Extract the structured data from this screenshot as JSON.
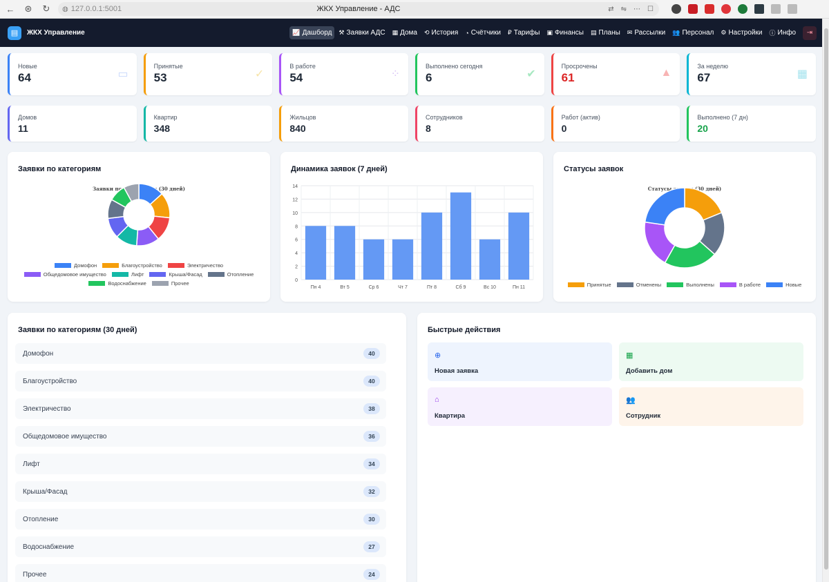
{
  "browser": {
    "url": "127.0.0.1:5001",
    "title": "ЖКХ Управление - АДС"
  },
  "navbar": {
    "brand": "ЖКХ Управление",
    "items": [
      {
        "label": "Дашборд",
        "icon": "chart-line-icon",
        "glyph": "📈"
      },
      {
        "label": "Заявки АДС",
        "icon": "tools-icon",
        "glyph": "⚒"
      },
      {
        "label": "Дома",
        "icon": "building-icon",
        "glyph": "▦"
      },
      {
        "label": "История",
        "icon": "history-icon",
        "glyph": "⟲"
      },
      {
        "label": "Счётчики",
        "icon": "gauge-icon",
        "glyph": "◔"
      },
      {
        "label": "Тарифы",
        "icon": "ruble-icon",
        "glyph": "₽"
      },
      {
        "label": "Финансы",
        "icon": "money-icon",
        "glyph": "▣"
      },
      {
        "label": "Планы",
        "icon": "calendar-icon",
        "glyph": "▤"
      },
      {
        "label": "Рассылки",
        "icon": "envelope-icon",
        "glyph": "✉"
      },
      {
        "label": "Персонал",
        "icon": "users-icon",
        "glyph": "👥"
      },
      {
        "label": "Настройки",
        "icon": "gear-icon",
        "glyph": "⚙"
      },
      {
        "label": "Инфо",
        "icon": "info-icon",
        "glyph": "ⓘ"
      }
    ]
  },
  "stats_row1": [
    {
      "label": "Новые",
      "value": "64",
      "color": "#3b82f6",
      "value_color": "#1f2937",
      "icon": "ticket-icon",
      "glyph": "▭",
      "icon_color": "#c7d7fb"
    },
    {
      "label": "Принятые",
      "value": "53",
      "color": "#f59e0b",
      "value_color": "#1f2937",
      "icon": "check-icon",
      "glyph": "✓",
      "icon_color": "#f7e4a8"
    },
    {
      "label": "В работе",
      "value": "54",
      "color": "#a855f7",
      "value_color": "#1f2937",
      "icon": "spinner-icon",
      "glyph": "⁘",
      "icon_color": "#d9c3f7"
    },
    {
      "label": "Выполнено сегодня",
      "value": "6",
      "color": "#22c55e",
      "value_color": "#1f2937",
      "icon": "check-circle-icon",
      "glyph": "✔",
      "icon_color": "#a7e8c1"
    },
    {
      "label": "Просрочены",
      "value": "61",
      "color": "#ef4444",
      "value_color": "#dc2626",
      "icon": "warning-icon",
      "glyph": "▲",
      "icon_color": "#f8b4b4"
    },
    {
      "label": "За неделю",
      "value": "67",
      "color": "#06b6d4",
      "value_color": "#1f2937",
      "icon": "calendar-week-icon",
      "glyph": "▦",
      "icon_color": "#a5e3ee"
    }
  ],
  "stats_row2": [
    {
      "label": "Домов",
      "value": "11",
      "color": "#6366f1",
      "value_color": "#1f2937"
    },
    {
      "label": "Квартир",
      "value": "348",
      "color": "#14b8a6",
      "value_color": "#1f2937"
    },
    {
      "label": "Жильцов",
      "value": "840",
      "color": "#f59e0b",
      "value_color": "#1f2937"
    },
    {
      "label": "Сотрудников",
      "value": "8",
      "color": "#ef4466",
      "value_color": "#1f2937"
    },
    {
      "label": "Работ (актив)",
      "value": "0",
      "color": "#f97316",
      "value_color": "#1f2937"
    },
    {
      "label": "Выполнено (7 дн)",
      "value": "20",
      "color": "#22c55e",
      "value_color": "#16a34a"
    }
  ],
  "panels": {
    "categories_title": "Заявки по категориям",
    "dynamics_title": "Динамика заявок (7 дней)",
    "statuses_title": "Статусы заявок",
    "list_title": "Заявки по категориям (30 дней)",
    "quick_title": "Быстрые действия"
  },
  "chart_data": [
    {
      "type": "pie",
      "title": "Заявки по категориям (30 дней)",
      "donut": true,
      "legend_position": "bottom",
      "categories": [
        "Домофон",
        "Благоустройство",
        "Электричество",
        "Общедомовое имущество",
        "Лифт",
        "Крыша/Фасад",
        "Отопление",
        "Водоснабжение",
        "Прочее"
      ],
      "values": [
        40,
        40,
        38,
        36,
        34,
        32,
        30,
        27,
        24
      ],
      "colors": [
        "#3b82f6",
        "#f59e0b",
        "#ef4444",
        "#8b5cf6",
        "#14b8a6",
        "#6366f1",
        "#64748b",
        "#22c55e",
        "#9ca3af"
      ]
    },
    {
      "type": "bar",
      "title": "Динамика заявок (7 дней)",
      "categories": [
        "Пн 4",
        "Вт 5",
        "Ср 6",
        "Чт 7",
        "Пт 8",
        "Сб 9",
        "Вс 10",
        "Пн 11"
      ],
      "values": [
        8,
        8,
        6,
        6,
        10,
        13,
        6,
        10
      ],
      "ylim": [
        0,
        14
      ],
      "yticks": [
        0,
        2,
        4,
        6,
        8,
        10,
        12,
        14
      ],
      "grid": true,
      "color": "#6499f4"
    },
    {
      "type": "pie",
      "title": "Статусы заявок (30 дней)",
      "donut": true,
      "legend_position": "bottom",
      "categories": [
        "Принятые",
        "Отменены",
        "Выполнены",
        "В работе",
        "Новые"
      ],
      "values": [
        53,
        50,
        61,
        54,
        64
      ],
      "colors": [
        "#f59e0b",
        "#64748b",
        "#22c55e",
        "#a855f7",
        "#3b82f6"
      ]
    }
  ],
  "category_list": [
    {
      "name": "Домофон",
      "count": "40"
    },
    {
      "name": "Благоустройство",
      "count": "40"
    },
    {
      "name": "Электричество",
      "count": "38"
    },
    {
      "name": "Общедомовое имущество",
      "count": "36"
    },
    {
      "name": "Лифт",
      "count": "34"
    },
    {
      "name": "Крыша/Фасад",
      "count": "32"
    },
    {
      "name": "Отопление",
      "count": "30"
    },
    {
      "name": "Водоснабжение",
      "count": "27"
    },
    {
      "name": "Прочее",
      "count": "24"
    }
  ],
  "quick_actions": [
    {
      "label": "Новая заявка",
      "icon": "plus-circle-icon",
      "glyph": "⊕",
      "bg": "#eef4fe",
      "icon_color": "#2563eb"
    },
    {
      "label": "Добавить дом",
      "icon": "building-icon",
      "glyph": "▦",
      "bg": "#edfaf2",
      "icon_color": "#16a34a"
    },
    {
      "label": "Квартира",
      "icon": "home-icon",
      "glyph": "⌂",
      "bg": "#f6f0fe",
      "icon_color": "#9333ea"
    },
    {
      "label": "Сотрудник",
      "icon": "users-icon",
      "glyph": "👥",
      "bg": "#fef4ea",
      "icon_color": "#ea7a1a"
    }
  ]
}
